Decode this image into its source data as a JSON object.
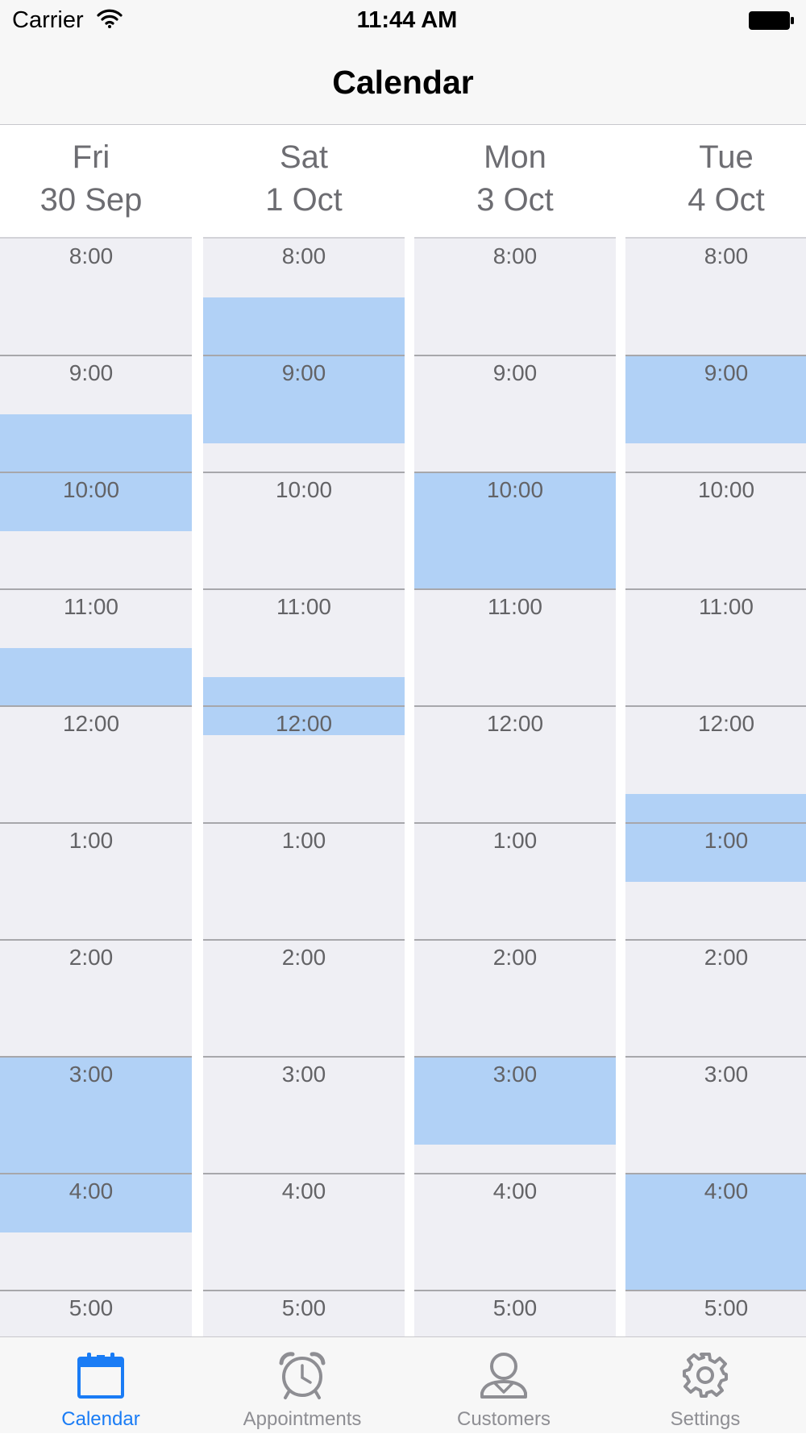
{
  "status_bar": {
    "carrier": "Carrier",
    "time": "11:44 AM"
  },
  "nav": {
    "title": "Calendar"
  },
  "hours": [
    "8:00",
    "9:00",
    "10:00",
    "11:00",
    "12:00",
    "1:00",
    "2:00",
    "3:00",
    "4:00",
    "5:00"
  ],
  "days": [
    {
      "name": "Fri",
      "date": "30 Sep",
      "appointments": [
        {
          "start": "9:30",
          "end": "10:30"
        },
        {
          "start": "11:30",
          "end": "12:00"
        },
        {
          "start": "3:00",
          "end": "4:30"
        }
      ]
    },
    {
      "name": "Sat",
      "date": "1 Oct",
      "appointments": [
        {
          "start": "8:30",
          "end": "9:45"
        },
        {
          "start": "11:45",
          "end": "12:15"
        }
      ]
    },
    {
      "name": "Mon",
      "date": "3 Oct",
      "appointments": [
        {
          "start": "10:00",
          "end": "11:00"
        },
        {
          "start": "3:00",
          "end": "3:45"
        }
      ]
    },
    {
      "name": "Tue",
      "date": "4 Oct",
      "appointments": [
        {
          "start": "9:00",
          "end": "9:45"
        },
        {
          "start": "12:45",
          "end": "1:30"
        },
        {
          "start": "4:00",
          "end": "5:00"
        }
      ]
    }
  ],
  "colors": {
    "accent": "#1a7cf5",
    "appointment": "#b1d1f6",
    "inactive": "#8e8e93"
  },
  "tabs": [
    {
      "label": "Calendar",
      "icon": "calendar-icon",
      "active": true
    },
    {
      "label": "Appointments",
      "icon": "alarm-clock-icon",
      "active": false
    },
    {
      "label": "Customers",
      "icon": "person-icon",
      "active": false
    },
    {
      "label": "Settings",
      "icon": "gear-icon",
      "active": false
    }
  ]
}
